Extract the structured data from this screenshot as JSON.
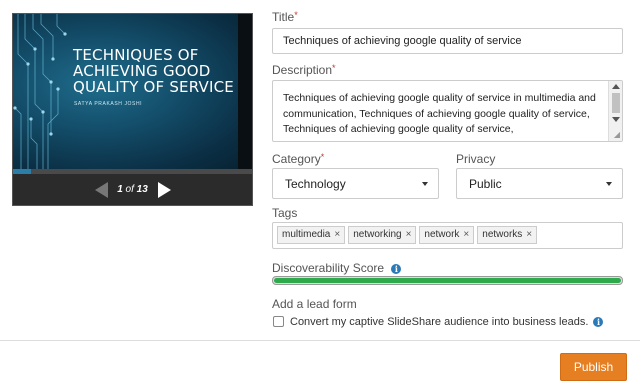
{
  "preview": {
    "slide_title": "Techniques of Achieving Good Quality of Service",
    "slide_author": "Satya Prakash Joshi",
    "current_page": "1",
    "page_of": "of",
    "total_pages": "13",
    "progress_fraction": 0.077
  },
  "form": {
    "title_label": "Title",
    "title_value": "Techniques of achieving google quality of service",
    "description_label": "Description",
    "description_value": "Techniques of achieving google quality of service in multimedia and communication, Techniques of achieving google quality of service, Techniques of achieving google quality of service,",
    "category_label": "Category",
    "category_value": "Technology",
    "privacy_label": "Privacy",
    "privacy_value": "Public",
    "tags_label": "Tags",
    "tags": [
      "multimedia",
      "networking",
      "network",
      "networks"
    ],
    "tag_remove_glyph": "×",
    "score_label": "Discoverability Score",
    "score_fraction": 1.0,
    "lead_form_label": "Add a lead form",
    "lead_form_checkbox_label": "Convert my captive SlideShare audience into business leads.",
    "required_marker": "*",
    "info_glyph": "i",
    "publish_label": "Publish"
  },
  "colors": {
    "accent_orange": "#e67e22",
    "score_green": "#2eaa4c",
    "info_blue": "#2a7ab8",
    "required_red": "#c0392b"
  }
}
